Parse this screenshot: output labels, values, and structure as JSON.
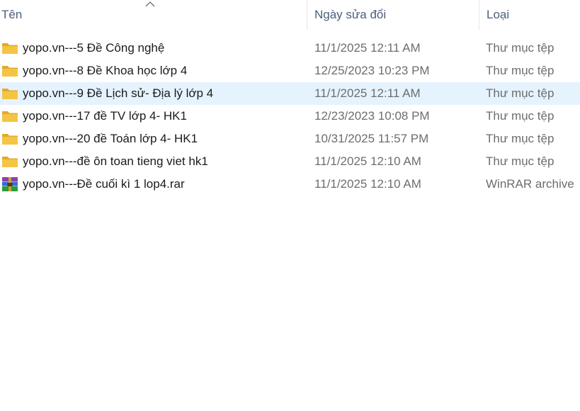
{
  "header": {
    "name_label": "Tên",
    "date_label": "Ngày sửa đổi",
    "type_label": "Loại"
  },
  "colors": {
    "folder": "#f4c542",
    "selected_row": "#e5f3ff",
    "header_text": "#4c607a",
    "secondary_text": "#6d6d6d"
  },
  "files": [
    {
      "name": "yopo.vn---5 Đề Công nghệ",
      "date": "11/1/2025 12:11 AM",
      "type": "Thư mục tệp",
      "icon": "folder-icon"
    },
    {
      "name": "yopo.vn---8 Đề Khoa học lớp 4",
      "date": "12/25/2023 10:23 PM",
      "type": "Thư mục tệp",
      "icon": "folder-icon"
    },
    {
      "name": "yopo.vn---9 Đề Lịch sử- Địa lý lớp 4",
      "date": "11/1/2025 12:11 AM",
      "type": "Thư mục tệp",
      "icon": "folder-icon",
      "selected": true
    },
    {
      "name": "yopo.vn---17 đề TV lớp 4- HK1",
      "date": "12/23/2023 10:08 PM",
      "type": "Thư mục tệp",
      "icon": "folder-icon"
    },
    {
      "name": "yopo.vn---20 đề Toán lớp 4- HK1",
      "date": "10/31/2025 11:57 PM",
      "type": "Thư mục tệp",
      "icon": "folder-icon"
    },
    {
      "name": "yopo.vn---đề ôn toan tieng viet hk1",
      "date": "11/1/2025 12:10 AM",
      "type": "Thư mục tệp",
      "icon": "folder-icon"
    },
    {
      "name": "yopo.vn---Đề cuối kì 1 lop4.rar",
      "date": "11/1/2025 12:10 AM",
      "type": "WinRAR archive",
      "icon": "winrar-archive-icon"
    }
  ]
}
